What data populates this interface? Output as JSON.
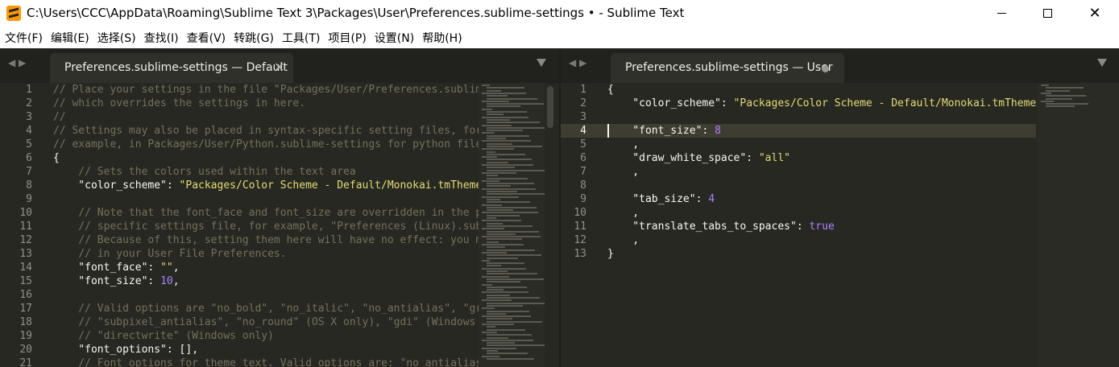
{
  "window": {
    "title": "C:\\Users\\CCC\\AppData\\Roaming\\Sublime Text 3\\Packages\\User\\Preferences.sublime-settings • - Sublime Text",
    "minimize_glyph": "",
    "maximize_glyph": "",
    "close_glyph": "✕"
  },
  "menu": [
    "文件(F)",
    "编辑(E)",
    "选择(S)",
    "查找(I)",
    "查看(V)",
    "转跳(G)",
    "工具(T)",
    "项目(P)",
    "设置(N)",
    "帮助(H)"
  ],
  "left_pane": {
    "nav": "◀ ▶",
    "tab_label": "Preferences.sublime-settings — Default",
    "tab_close": "✕",
    "lines": [
      {
        "n": "1",
        "segs": [
          {
            "t": "// Place your settings in the file \"Packages/User/Preferences.sublime-",
            "c": "comment"
          }
        ]
      },
      {
        "n": "2",
        "segs": [
          {
            "t": "// which overrides the settings in here.",
            "c": "comment"
          }
        ]
      },
      {
        "n": "3",
        "segs": [
          {
            "t": "//",
            "c": "comment"
          }
        ]
      },
      {
        "n": "4",
        "segs": [
          {
            "t": "// Settings may also be placed in syntax-specific setting files, for",
            "c": "comment"
          }
        ]
      },
      {
        "n": "5",
        "segs": [
          {
            "t": "// example, in Packages/User/Python.sublime-settings for python files.",
            "c": "comment"
          }
        ]
      },
      {
        "n": "6",
        "segs": [
          {
            "t": "{",
            "c": "punct"
          }
        ]
      },
      {
        "n": "7",
        "segs": [
          {
            "t": "    // Sets the colors used within the text area",
            "c": "comment"
          }
        ]
      },
      {
        "n": "8",
        "segs": [
          {
            "t": "    \"color_scheme\"",
            "c": "punct"
          },
          {
            "t": ": ",
            "c": "punct"
          },
          {
            "t": "\"Packages/Color Scheme - Default/Monokai.tmTheme\"",
            "c": "string"
          },
          {
            "t": ",",
            "c": "punct"
          }
        ]
      },
      {
        "n": "9",
        "segs": []
      },
      {
        "n": "10",
        "segs": [
          {
            "t": "    // Note that the font_face and font_size are overridden in the pla",
            "c": "comment"
          }
        ]
      },
      {
        "n": "11",
        "segs": [
          {
            "t": "    // specific settings file, for example, \"Preferences (Linux).subli",
            "c": "comment"
          }
        ]
      },
      {
        "n": "12",
        "segs": [
          {
            "t": "    // Because of this, setting them here will have no effect: you mus",
            "c": "comment"
          }
        ]
      },
      {
        "n": "13",
        "segs": [
          {
            "t": "    // in your User File Preferences.",
            "c": "comment"
          }
        ]
      },
      {
        "n": "14",
        "segs": [
          {
            "t": "    \"font_face\"",
            "c": "punct"
          },
          {
            "t": ": ",
            "c": "punct"
          },
          {
            "t": "\"\"",
            "c": "string"
          },
          {
            "t": ",",
            "c": "punct"
          }
        ]
      },
      {
        "n": "15",
        "segs": [
          {
            "t": "    \"font_size\"",
            "c": "punct"
          },
          {
            "t": ": ",
            "c": "punct"
          },
          {
            "t": "10",
            "c": "num"
          },
          {
            "t": ",",
            "c": "punct"
          }
        ]
      },
      {
        "n": "16",
        "segs": []
      },
      {
        "n": "17",
        "segs": [
          {
            "t": "    // Valid options are \"no_bold\", \"no_italic\", \"no_antialias\", \"gray",
            "c": "comment"
          }
        ]
      },
      {
        "n": "18",
        "segs": [
          {
            "t": "    // \"subpixel_antialias\", \"no_round\" (OS X only), \"gdi\" (Windows on",
            "c": "comment"
          }
        ]
      },
      {
        "n": "19",
        "segs": [
          {
            "t": "    // \"directwrite\" (Windows only)",
            "c": "comment"
          }
        ]
      },
      {
        "n": "20",
        "segs": [
          {
            "t": "    \"font_options\"",
            "c": "punct"
          },
          {
            "t": ": [],",
            "c": "punct"
          }
        ]
      },
      {
        "n": "21",
        "segs": [
          {
            "t": "    // Font options for theme text. Valid options are: \"no_antialias\",",
            "c": "comment"
          }
        ]
      }
    ]
  },
  "right_pane": {
    "nav": "◀ ▶",
    "tab_label": "Preferences.sublime-settings — User",
    "lines": [
      {
        "n": "1",
        "segs": [
          {
            "t": "{",
            "c": "punct"
          }
        ]
      },
      {
        "n": "2",
        "segs": [
          {
            "t": "    \"color_scheme\"",
            "c": "punct"
          },
          {
            "t": ": ",
            "c": "punct"
          },
          {
            "t": "\"Packages/Color Scheme - Default/Monokai.tmTheme\"",
            "c": "string"
          },
          {
            "t": ",",
            "c": "punct"
          }
        ]
      },
      {
        "n": "3",
        "segs": []
      },
      {
        "n": "4",
        "segs": [
          {
            "t": "    \"font_size\"",
            "c": "punct"
          },
          {
            "t": ": ",
            "c": "punct"
          },
          {
            "t": "8",
            "c": "num"
          }
        ]
      },
      {
        "n": "5",
        "segs": [
          {
            "t": "    ,",
            "c": "punct"
          }
        ]
      },
      {
        "n": "6",
        "segs": [
          {
            "t": "    \"draw_white_space\"",
            "c": "punct"
          },
          {
            "t": ": ",
            "c": "punct"
          },
          {
            "t": "\"all\"",
            "c": "string"
          }
        ]
      },
      {
        "n": "7",
        "segs": [
          {
            "t": "    ,",
            "c": "punct"
          }
        ]
      },
      {
        "n": "8",
        "segs": []
      },
      {
        "n": "9",
        "segs": [
          {
            "t": "    \"tab_size\"",
            "c": "punct"
          },
          {
            "t": ": ",
            "c": "punct"
          },
          {
            "t": "4",
            "c": "num"
          }
        ]
      },
      {
        "n": "10",
        "segs": [
          {
            "t": "    ,",
            "c": "punct"
          }
        ]
      },
      {
        "n": "11",
        "segs": [
          {
            "t": "    \"translate_tabs_to_spaces\"",
            "c": "punct"
          },
          {
            "t": ": ",
            "c": "punct"
          },
          {
            "t": "true",
            "c": "bool"
          }
        ]
      },
      {
        "n": "12",
        "segs": [
          {
            "t": "    ,",
            "c": "punct"
          }
        ]
      },
      {
        "n": "13",
        "segs": [
          {
            "t": "}",
            "c": "punct"
          }
        ]
      }
    ],
    "current_line": "4"
  },
  "colors": {
    "background": "#272822",
    "comment": "#75715e",
    "string": "#e6db74",
    "number": "#ae81ff",
    "text": "#f8f8f2",
    "line_number": "#8f908a"
  }
}
